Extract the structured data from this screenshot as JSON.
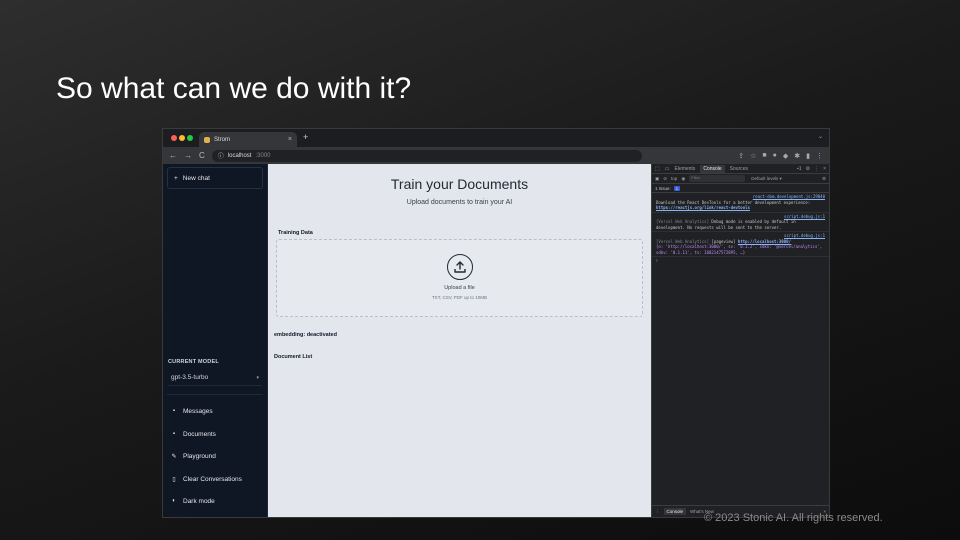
{
  "slide": {
    "title": "So what can we do with it?",
    "copyright": "© 2023 Stonic AI. All rights reserved."
  },
  "browser": {
    "tab_title": "Strom",
    "tab_close": "×",
    "new_tab": "+",
    "url_host": "localhost",
    "url_port": ":3000",
    "nav_back": "←",
    "nav_forward": "→",
    "nav_reload": "C",
    "tab_menu": "⌄"
  },
  "sidebar": {
    "new_chat_icon": "+",
    "new_chat_label": "New chat",
    "current_model_label": "CURRENT MODEL",
    "model_value": "gpt-3.5-turbo",
    "items": [
      {
        "icon": "messages-icon",
        "glyph": "▪",
        "label": "Messages"
      },
      {
        "icon": "documents-icon",
        "glyph": "▪",
        "label": "Documents"
      },
      {
        "icon": "wrench-icon",
        "glyph": "✎",
        "label": "Playground"
      },
      {
        "icon": "trash-icon",
        "glyph": "▯",
        "label": "Clear Conversations"
      },
      {
        "icon": "moon-icon",
        "glyph": "◐",
        "label": "Dark mode"
      }
    ]
  },
  "main": {
    "title": "Train your Documents",
    "subtitle": "Upload documents to train your AI",
    "training_label": "Training Data",
    "upload_label": "Upload a file",
    "upload_hint": "TXT, CSV, PDF up to 10MB",
    "embedding_status": "embedding: deactivated",
    "document_list_label": "Document List"
  },
  "devtools": {
    "tabs": [
      "Elements",
      "Console",
      "Sources"
    ],
    "active_tab": "Console",
    "top_label": "top",
    "filter_placeholder": "Filter",
    "levels_label": "Default levels ▾",
    "issues_label": "1 Issue:",
    "issues_count": "1",
    "logs": [
      {
        "source": "react-dom.development.js:29840",
        "text": "Download the React DevTools for a better development experience: ",
        "link": "https://reactjs.org/link/react-devtools"
      },
      {
        "source": "script.debug.js:1",
        "prefix": "[Vercel Web Analytics]",
        "text": "Debug mode is enabled by default in development. No requests will be sent to the server."
      },
      {
        "source": "script.debug.js:1",
        "prefix": "[Vercel Web Analytics]",
        "text": "[pageview] ",
        "link": "http://localhost:3000/",
        "obj": "{o: 'http://localhost:3000/', sv: '0.1.2', sdkn: '@vercel/analytics', sdkv: '0.1.11', ts: 1682147572895, …}"
      }
    ],
    "prompt": "›",
    "bottom_tabs": [
      "Console",
      "What's New"
    ],
    "close": "×"
  }
}
